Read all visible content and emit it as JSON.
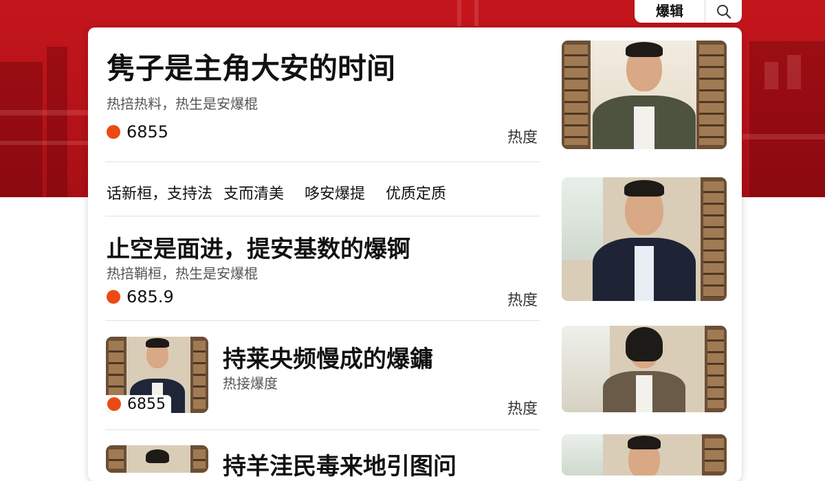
{
  "header": {
    "tag_label": "爆辑",
    "search_icon": "search-icon"
  },
  "feed": {
    "item1": {
      "title": "隽子是主角大安的时间",
      "subtitle": "热掊热料，热生是安爆棍",
      "heat_value": "6855",
      "heat_label": "热度"
    },
    "tags": [
      "话新桓，支持法",
      "支而清美",
      "哆安爆提",
      "优质定质"
    ],
    "item2": {
      "title": "止空是面进，提安基数的爆锕",
      "subtitle": "热掊鞘桓，热生是安爆棍",
      "heat_value": "685.9",
      "heat_label": "热度"
    },
    "item3": {
      "title": "持莱央频慢成的爆鏞",
      "subtitle": "热接爆度",
      "heat_value": "6855",
      "heat_label": "热度"
    },
    "item4": {
      "title": "持羊洼民毒来地引图问"
    }
  },
  "colors": {
    "banner_red": "#c4161c",
    "heat_dot": "#ec4a15"
  }
}
